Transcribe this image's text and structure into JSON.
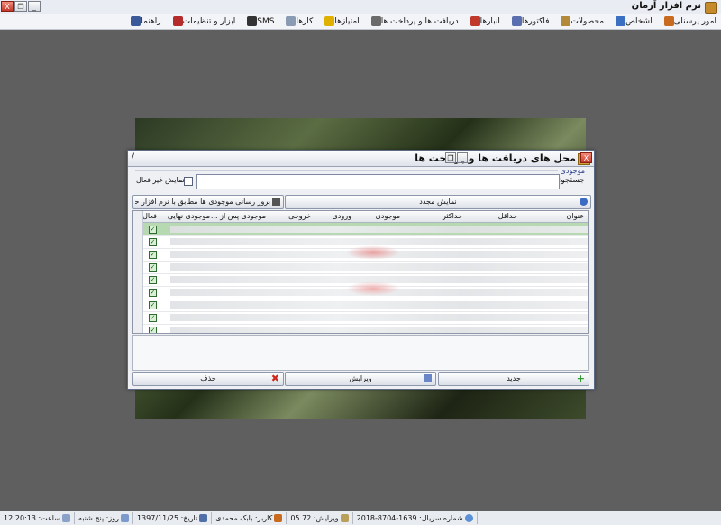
{
  "app": {
    "title": "نرم افزار آرمان"
  },
  "window_buttons": {
    "close": "X",
    "restore": "❐",
    "minimize": "_"
  },
  "menu": [
    {
      "label": "امور پرسنلی",
      "icon": "people-icon",
      "color": "#c96b1e"
    },
    {
      "label": "اشخاص",
      "icon": "person-icon",
      "color": "#3b6fc2"
    },
    {
      "label": "محصولات",
      "icon": "box-icon",
      "color": "#b38a3a"
    },
    {
      "label": "فاکتورها",
      "icon": "invoice-icon",
      "color": "#5a6fb0"
    },
    {
      "label": "انبارها",
      "icon": "warehouse-icon",
      "color": "#c0392b"
    },
    {
      "label": "دریافت ها و پرداخت ها",
      "icon": "money-icon",
      "color": "#6b6b6b"
    },
    {
      "label": "امتیازها",
      "icon": "star-icon",
      "color": "#e0b000"
    },
    {
      "label": "کارها",
      "icon": "tasks-icon",
      "color": "#8a9bb4"
    },
    {
      "label": "SMS",
      "icon": "sms-icon",
      "color": "#333333"
    },
    {
      "label": "ابزار و تنظیمات",
      "icon": "tools-icon",
      "color": "#b52b2b"
    },
    {
      "label": "راهنما",
      "icon": "help-icon",
      "color": "#3a5a9a"
    }
  ],
  "dialog": {
    "title": "محل های دریافت ها و پرداخت ها",
    "corner_mark": "/",
    "group_caption": "موجودی",
    "search_label": "جستجو:",
    "search_value": "",
    "show_inactive_label": "نمایش غیر فعال",
    "refresh_label": "نمایش مجدد",
    "update_balance_label": "بروز رسانی موجودی ها مطابق با نرم افزار حسابداری",
    "columns": [
      "عنوان",
      "حداقل",
      "حداکثر",
      "موجودی",
      "ورودی",
      "خروجی",
      "موجودی پس از ...",
      "موجودی نهایی",
      "فعال"
    ],
    "rows": [
      {
        "active": true
      },
      {
        "active": true
      },
      {
        "active": true
      },
      {
        "active": true
      },
      {
        "active": true
      },
      {
        "active": true
      },
      {
        "active": true
      },
      {
        "active": true
      },
      {
        "active": true
      }
    ],
    "new_label": "جدید",
    "edit_label": "ویرایش",
    "delete_label": "حذف"
  },
  "status": {
    "serial": "شماره سریال: 1639-8704-2018",
    "version": "ویرایش: 05.72",
    "user": "کاربر: بابک محمدی",
    "date": "تاریخ: 1397/11/25",
    "day": "روز: پنج شنبه",
    "time": "ساعت: 12:20:13"
  }
}
